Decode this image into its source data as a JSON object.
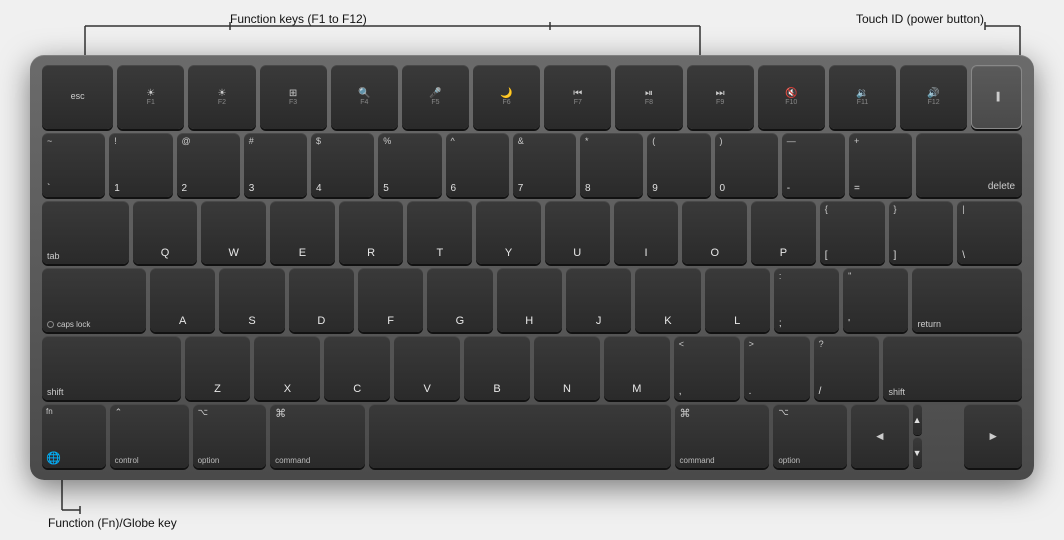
{
  "annotations": {
    "function_keys_label": "Function keys (F1 to F12)",
    "touch_id_label": "Touch ID (power button)",
    "globe_key_label": "Function (Fn)/Globe key"
  },
  "keyboard": {
    "rows": {
      "fn_row": [
        "esc",
        "F1",
        "F2",
        "F3",
        "F4",
        "F5",
        "F6",
        "F7",
        "F8",
        "F9",
        "F10",
        "F11",
        "F12",
        "TouchID"
      ],
      "number_row": [
        "~`",
        "!1",
        "@2",
        "#3",
        "$4",
        "%5",
        "^6",
        "&7",
        "*8",
        "(9",
        ")0",
        "—-",
        "+=",
        "delete"
      ],
      "qwerty_row": [
        "tab",
        "Q",
        "W",
        "E",
        "R",
        "T",
        "Y",
        "U",
        "I",
        "O",
        "P",
        "{[",
        "]}",
        "|\\ "
      ],
      "home_row": [
        "caps lock",
        "A",
        "S",
        "D",
        "F",
        "G",
        "H",
        "J",
        "K",
        "L",
        ";:",
        "\"'",
        "return"
      ],
      "shift_row": [
        "shift",
        "Z",
        "X",
        "C",
        "V",
        "B",
        "N",
        "M",
        "<,",
        ">.",
        "?/",
        "shift"
      ],
      "bottom_row": [
        "fn/globe",
        "control",
        "option",
        "command",
        "space",
        "command",
        "option",
        "◄",
        "▲▼",
        "►"
      ]
    }
  },
  "colors": {
    "bg": "#efefef",
    "keyboard_body": "#555555",
    "key_dark": "#2e2e2e",
    "key_text": "#e0e0e0",
    "annotation_text": "#111111"
  }
}
